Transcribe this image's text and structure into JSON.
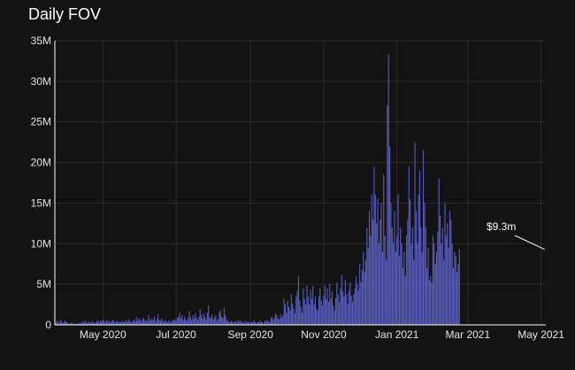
{
  "chart_data": {
    "type": "bar",
    "title": "Daily FOV",
    "xlabel": "",
    "ylabel": "",
    "ylim": [
      0,
      35000000
    ],
    "xlim": [
      "2020-03-22",
      "2021-05-05"
    ],
    "grid": true,
    "legend": "none",
    "bar_color": "#5C5EC2",
    "y_ticks": [
      {
        "value": 0,
        "label": "0"
      },
      {
        "value": 5000000,
        "label": "5M"
      },
      {
        "value": 10000000,
        "label": "10M"
      },
      {
        "value": 15000000,
        "label": "15M"
      },
      {
        "value": 20000000,
        "label": "20M"
      },
      {
        "value": 25000000,
        "label": "25M"
      },
      {
        "value": 30000000,
        "label": "30M"
      },
      {
        "value": 35000000,
        "label": "35M"
      }
    ],
    "x_ticks": [
      {
        "date": "2020-05-01",
        "label": "May 2020"
      },
      {
        "date": "2020-07-01",
        "label": "Jul 2020"
      },
      {
        "date": "2020-09-01",
        "label": "Sep 2020"
      },
      {
        "date": "2020-11-01",
        "label": "Nov 2020"
      },
      {
        "date": "2021-01-01",
        "label": "Jan 2021"
      },
      {
        "date": "2021-03-01",
        "label": "Mar 2021"
      },
      {
        "date": "2021-05-01",
        "label": "May 2021"
      }
    ],
    "annotation": {
      "text": "$9.3m",
      "date": "2021-05-04",
      "value": 9300000
    },
    "series": [
      {
        "start_date": "2020-03-23",
        "values": [
          0.3,
          0.5,
          0.2,
          0.4,
          0.6,
          0.3,
          0.2,
          0.4,
          0.5,
          0.3,
          0.2,
          0.1,
          0.2,
          0.3,
          0.1,
          0.2,
          0.1,
          0.2,
          0.1,
          0.2,
          0.3,
          0.2,
          0.4,
          0.2,
          0.5,
          0.3,
          0.2,
          0.4,
          0.3,
          0.2,
          0.5,
          0.3,
          0.2,
          0.3,
          0.4,
          0.6,
          0.3,
          0.5,
          0.4,
          0.7,
          0.5,
          0.3,
          0.6,
          0.4,
          0.5,
          0.3,
          0.4,
          0.6,
          0.5,
          0.3,
          0.4,
          0.5,
          0.3,
          0.4,
          0.3,
          0.5,
          0.4,
          0.3,
          0.6,
          0.4,
          0.5,
          0.7,
          0.4,
          0.3,
          0.5,
          0.6,
          0.4,
          1.0,
          0.5,
          0.8,
          0.6,
          0.4,
          0.7,
          0.9,
          0.5,
          0.6,
          0.4,
          1.2,
          0.7,
          0.5,
          0.8,
          0.6,
          1.0,
          0.4,
          0.7,
          1.3,
          0.6,
          0.5,
          0.8,
          0.5,
          0.3,
          0.6,
          0.4,
          0.3,
          0.5,
          0.4,
          0.3,
          0.6,
          0.5,
          0.7,
          0.5,
          0.9,
          1.0,
          1.5,
          0.8,
          1.2,
          0.6,
          1.0,
          0.7,
          0.5,
          0.8,
          1.7,
          1.0,
          0.6,
          1.2,
          0.8,
          1.4,
          0.9,
          0.6,
          1.0,
          1.9,
          1.2,
          0.8,
          1.4,
          1.0,
          0.7,
          1.5,
          2.4,
          1.0,
          0.8,
          1.3,
          0.6,
          0.9,
          1.2,
          0.5,
          0.7,
          1.5,
          1.8,
          1.0,
          0.8,
          2.1,
          1.2,
          0.7,
          0.5,
          0.4,
          0.3,
          0.5,
          0.4,
          0.3,
          0.4,
          0.5,
          0.3,
          0.6,
          0.4,
          0.5,
          0.3,
          0.4,
          0.2,
          0.5,
          0.3,
          0.4,
          0.3,
          0.2,
          0.4,
          0.3,
          0.6,
          0.3,
          0.2,
          0.4,
          0.3,
          0.5,
          0.4,
          0.3,
          0.2,
          0.5,
          0.4,
          0.6,
          0.4,
          0.3,
          0.8,
          1.0,
          0.6,
          0.9,
          1.4,
          1.2,
          0.8,
          0.7,
          1.3,
          0.9,
          1.2,
          3.2,
          2.5,
          1.5,
          3.0,
          2.2,
          1.8,
          3.8,
          2.6,
          2.0,
          1.4,
          3.5,
          4.2,
          6.0,
          3.0,
          2.2,
          1.5,
          4.5,
          3.2,
          2.5,
          4.8,
          3.5,
          2.5,
          4.3,
          3.2,
          4.8,
          2.5,
          3.5,
          2.0,
          1.8,
          3.5,
          4.5,
          3.0,
          2.4,
          3.6,
          4.8,
          3.2,
          4.5,
          2.8,
          5.0,
          3.2,
          4.1,
          2.4,
          1.8,
          3.3,
          5.2,
          3.8,
          2.8,
          4.5,
          6.2,
          4.1,
          3.5,
          5.5,
          3.8,
          2.6,
          4.2,
          5.2,
          3.6,
          2.8,
          3.8,
          4.5,
          6.0,
          5.0,
          4.2,
          7.5,
          5.3,
          6.8,
          9.0,
          6.5,
          8.0,
          12.0,
          9.5,
          14.0,
          11.0,
          16.0,
          13.0,
          19.5,
          16.0,
          12.5,
          15.5,
          10.0,
          13.0,
          15.0,
          9.0,
          18.5,
          11.0,
          8.0,
          27.0,
          33.3,
          22.0,
          15.0,
          12.0,
          10.0,
          14.0,
          9.0,
          11.0,
          16.0,
          8.5,
          12.0,
          10.0,
          7.0,
          9.0,
          6.0,
          11.0,
          13.0,
          19.5,
          15.5,
          10.0,
          12.0,
          8.0,
          22.5,
          14.0,
          10.0,
          16.0,
          19.0,
          12.0,
          9.0,
          21.5,
          15.0,
          12.0,
          7.0,
          9.5,
          5.5,
          6.0,
          5.2,
          11.0,
          10.0,
          7.5,
          9.0,
          11.5,
          18.0,
          13.5,
          10.0,
          12.0,
          8.0,
          15.0,
          11.0,
          12.5,
          9.5,
          14.0,
          13.0,
          10.0,
          7.0,
          9.0,
          8.5,
          6.5,
          7.5,
          9.3
        ]
      }
    ]
  }
}
